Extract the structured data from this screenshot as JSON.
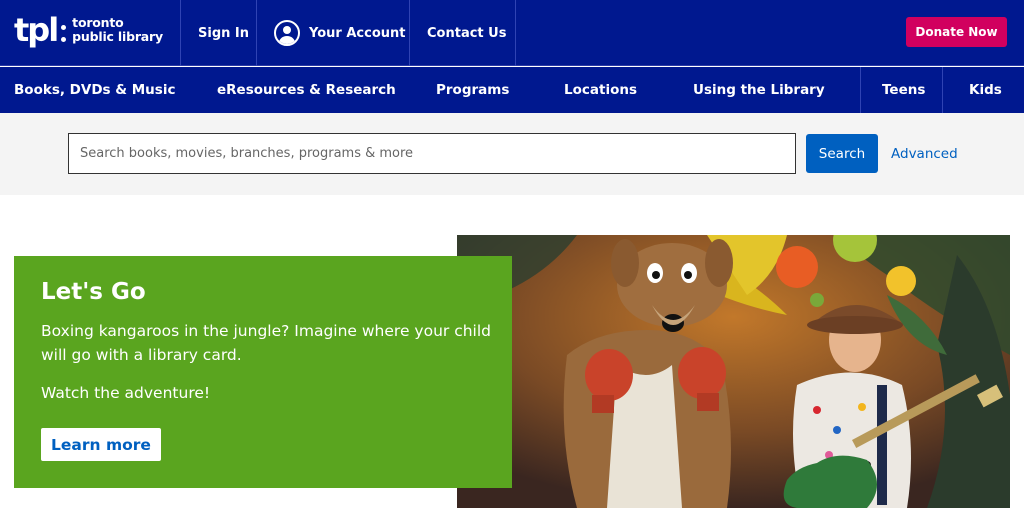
{
  "header": {
    "logo_mark": "tpl",
    "logo_line1": "toronto",
    "logo_line2": "public library",
    "sign_in": "Sign In",
    "your_account": "Your Account",
    "contact_us": "Contact Us",
    "donate": "Donate Now"
  },
  "nav": {
    "items": [
      "Books, DVDs & Music",
      "eResources & Research",
      "Programs",
      "Locations",
      "Using the Library",
      "Teens",
      "Kids"
    ]
  },
  "search": {
    "placeholder": "Search books, movies, branches, programs & more",
    "button": "Search",
    "advanced": "Advanced"
  },
  "hero": {
    "title": "Let's Go",
    "body": "Boxing kangaroos in the jungle? Imagine where your child will go with a library card.",
    "body2": "Watch the adventure!",
    "cta": "Learn more",
    "image_desc": "kangaroo-costume-boxer-and-child-with-guitar-photo"
  },
  "colors": {
    "brand_navy": "#00188f",
    "donate_pink": "#d1005f",
    "hero_green": "#5aa51f",
    "link_blue": "#0060c0"
  }
}
